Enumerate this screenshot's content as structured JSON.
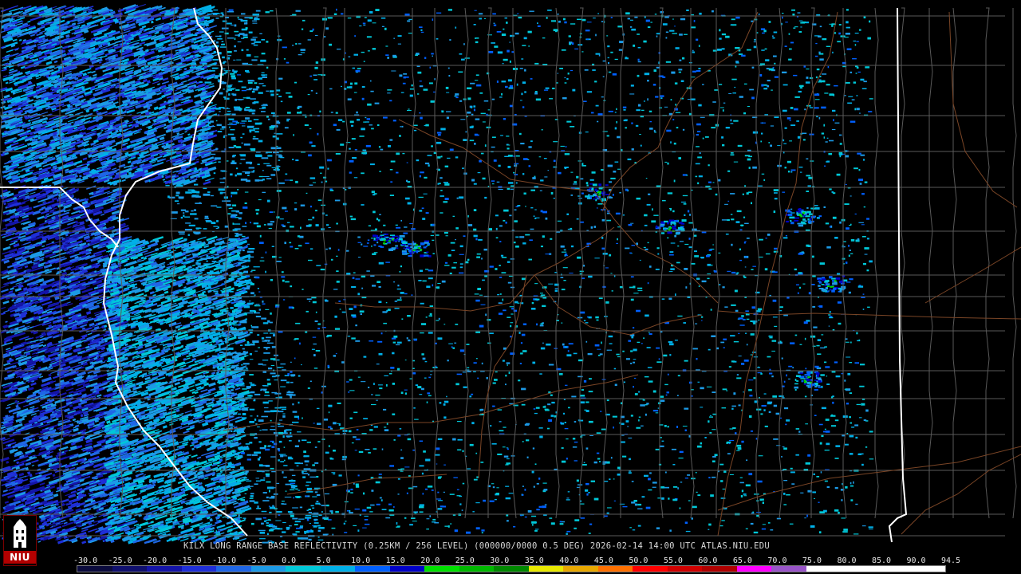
{
  "product": {
    "caption": "KILX LONG RANGE BASE REFLECTIVITY (0.25KM / 256 LEVEL) (000000/0000 0.5 DEG) 2026-02-14 14:00 UTC  ATLAS.NIU.EDU"
  },
  "logo": {
    "text": "NIU",
    "icon": "niu-tower-icon"
  },
  "colors": {
    "background": "#000000",
    "county_line": "#5a5a5a",
    "state_line": "#ffffff",
    "interstate": "#7a4526"
  },
  "scale": {
    "labels": [
      "-30.0",
      "-25.0",
      "-20.0",
      "-15.0",
      "-10.0",
      "-5.0",
      "0.0",
      "5.0",
      "10.0",
      "15.0",
      "20.0",
      "25.0",
      "30.0",
      "35.0",
      "40.0",
      "45.0",
      "50.0",
      "55.0",
      "60.0",
      "65.0",
      "70.0",
      "75.0",
      "80.0",
      "85.0",
      "90.0",
      "94.5"
    ],
    "colors": [
      "#0b0b3d",
      "#10106e",
      "#1414a8",
      "#1f2fd8",
      "#1f66e6",
      "#1c9ae6",
      "#00c8d8",
      "#00b0e8",
      "#0060ff",
      "#0000c8",
      "#00e000",
      "#00b800",
      "#008800",
      "#e8e800",
      "#e8a800",
      "#ff7000",
      "#ff0000",
      "#d00000",
      "#b00000",
      "#ff00ff",
      "#9955c8",
      "#ffffff",
      "#ffffff",
      "#ffffff",
      "#ffffff"
    ]
  }
}
